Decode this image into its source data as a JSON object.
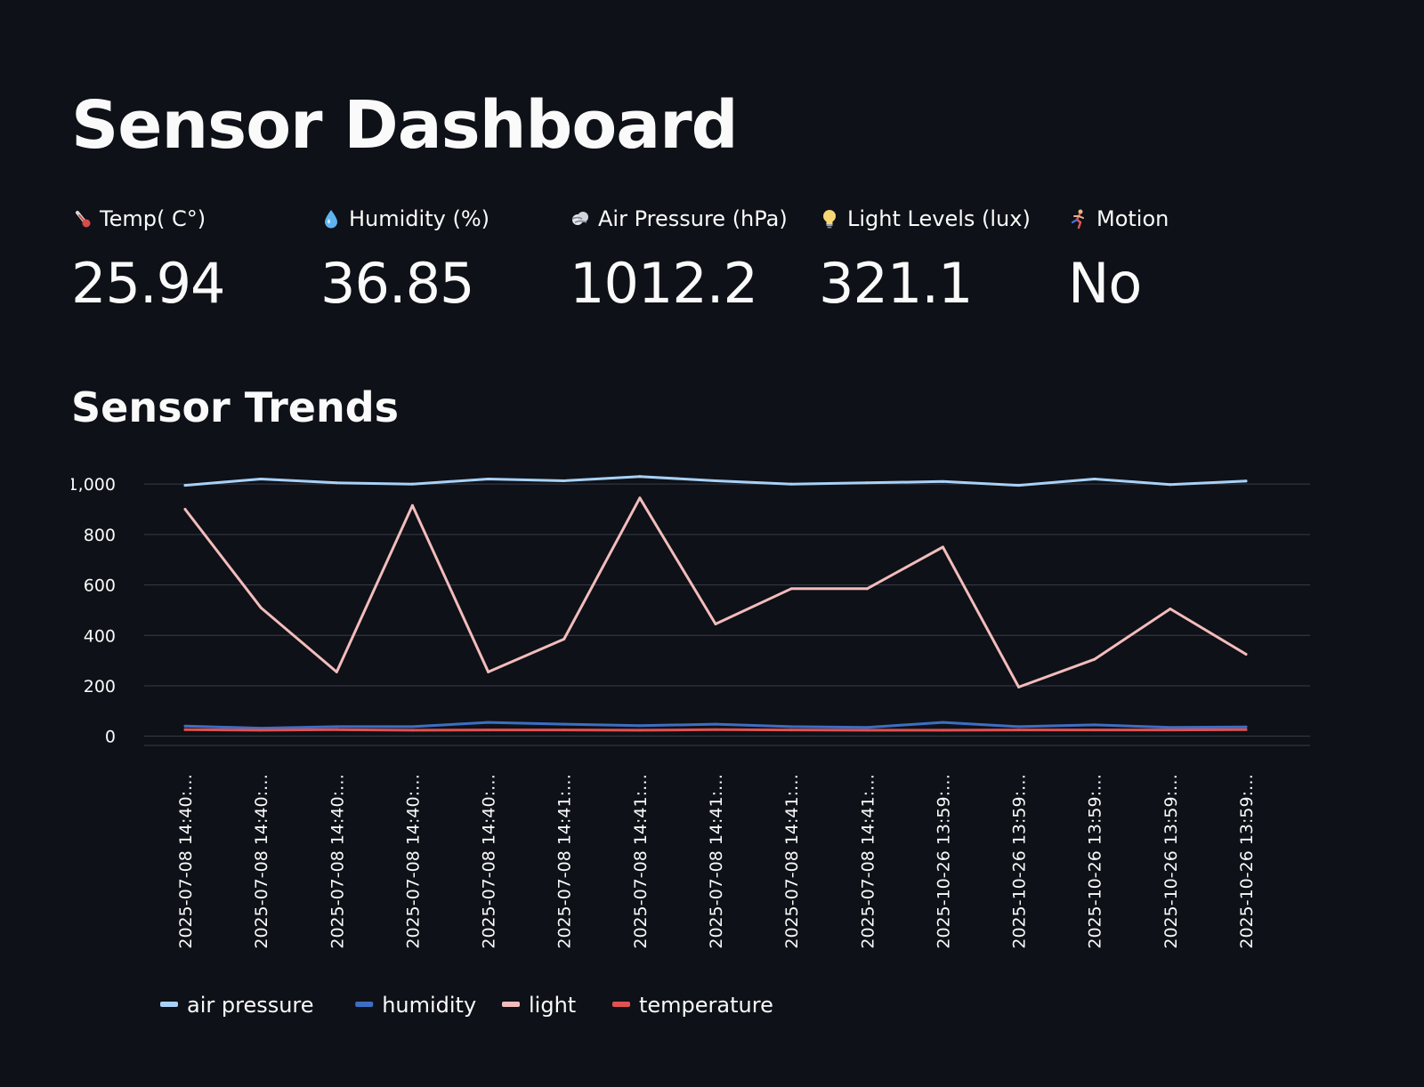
{
  "page": {
    "title": "Sensor Dashboard",
    "section_title": "Sensor Trends"
  },
  "metrics": [
    {
      "icon": "thermometer-icon",
      "label": "Temp( C°)",
      "value": "25.94"
    },
    {
      "icon": "droplet-icon",
      "label": "Humidity (%)",
      "value": "36.85"
    },
    {
      "icon": "wind-icon",
      "label": "Air Pressure (hPa)",
      "value": "1012.2"
    },
    {
      "icon": "lightbulb-icon",
      "label": "Light Levels (lux)",
      "value": "321.1"
    },
    {
      "icon": "running-person-icon",
      "label": "Motion",
      "value": "No"
    }
  ],
  "colors": {
    "background": "#0e1117",
    "text": "#fafafa",
    "grid": "#3a3d47"
  },
  "chart_data": {
    "type": "line",
    "x": [
      "2025-07-08 14:40:…",
      "2025-07-08 14:40:…",
      "2025-07-08 14:40:…",
      "2025-07-08 14:40:…",
      "2025-07-08 14:40:…",
      "2025-07-08 14:41:…",
      "2025-07-08 14:41:…",
      "2025-07-08 14:41:…",
      "2025-07-08 14:41:…",
      "2025-07-08 14:41:…",
      "2025-10-26 13:59:…",
      "2025-10-26 13:59:…",
      "2025-10-26 13:59:…",
      "2025-10-26 13:59:…",
      "2025-10-26 13:59:…"
    ],
    "ylim": [
      -40,
      1050
    ],
    "yticks": [
      {
        "value": 1000,
        "label": "1,000"
      },
      {
        "value": 800,
        "label": "800"
      },
      {
        "value": 600,
        "label": "600"
      },
      {
        "value": 400,
        "label": "400"
      },
      {
        "value": 200,
        "label": "200"
      },
      {
        "value": 0,
        "label": "0"
      }
    ],
    "grid": true,
    "legend_position": "bottom-left",
    "series": [
      {
        "name": "air pressure",
        "color": "#a9d1f7",
        "values": [
          995,
          1020,
          1005,
          1000,
          1020,
          1013,
          1030,
          1013,
          1000,
          1005,
          1010,
          995,
          1020,
          998,
          1012
        ]
      },
      {
        "name": "humidity",
        "color": "#3c6fc4",
        "values": [
          40,
          32,
          38,
          38,
          55,
          48,
          42,
          48,
          38,
          35,
          55,
          38,
          45,
          35,
          37
        ]
      },
      {
        "name": "light",
        "color": "#f3bcbc",
        "values": [
          900,
          510,
          255,
          915,
          255,
          385,
          945,
          445,
          585,
          585,
          750,
          195,
          305,
          505,
          325
        ]
      },
      {
        "name": "temperature",
        "color": "#e25151",
        "values": [
          26,
          24,
          26,
          24,
          25,
          25,
          24,
          26,
          25,
          24,
          24,
          25,
          25,
          25,
          26
        ]
      }
    ]
  }
}
